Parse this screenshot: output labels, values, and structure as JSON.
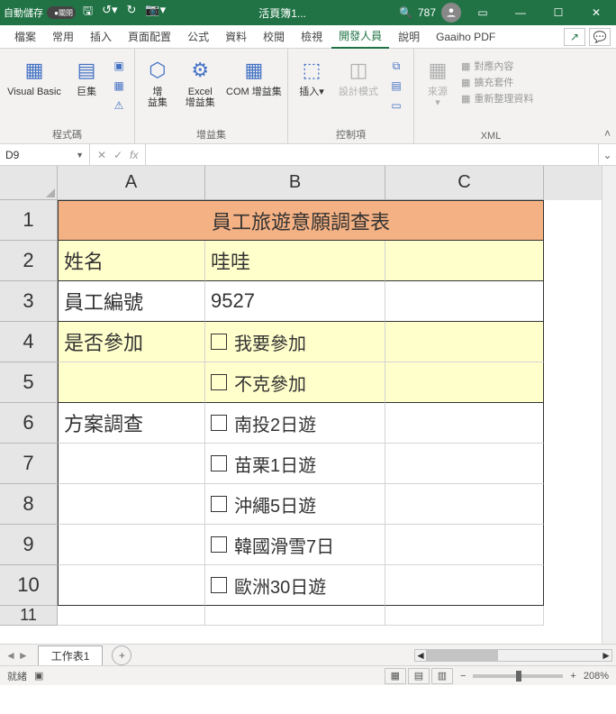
{
  "titlebar": {
    "autosave_label": "自動儲存",
    "autosave_state": "●關閉",
    "doc_name": "活頁簿1...",
    "user_label": "787"
  },
  "menu": {
    "tabs": [
      "檔案",
      "常用",
      "插入",
      "頁面配置",
      "公式",
      "資料",
      "校閱",
      "檢視",
      "開發人員",
      "說明",
      "Gaaiho PDF"
    ],
    "active": "開發人員"
  },
  "ribbon": {
    "group_code": "程式碼",
    "vb_label": "Visual Basic",
    "macro_label": "巨集",
    "group_addins": "增益集",
    "addin_label": "增\n益集",
    "excel_addin_label": "Excel\n增益集",
    "com_addin_label": "COM 增益集",
    "group_controls": "控制項",
    "insert_label": "插入",
    "design_label": "設計模式",
    "group_xml": "XML",
    "source_label": "來源",
    "xml_map": "對應內容",
    "xml_expand": "擴充套件",
    "xml_refresh": "重新整理資料"
  },
  "fbar": {
    "namebox": "D9",
    "fx": "fx"
  },
  "grid": {
    "cols": [
      "A",
      "B",
      "C"
    ],
    "rows": [
      "1",
      "2",
      "3",
      "4",
      "5",
      "6",
      "7",
      "8",
      "9",
      "10",
      "11"
    ],
    "title": "員工旅遊意願調查表",
    "r2a": "姓名",
    "r2b": "哇哇",
    "r3a": "員工編號",
    "r3b": "9527",
    "r4a": "是否參加",
    "r4b": "我要參加",
    "r5b": "不克參加",
    "r6a": "方案調查",
    "r6b": "南投2日遊",
    "r7b": "苗栗1日遊",
    "r8b": "沖繩5日遊",
    "r9b": "韓國滑雪7日",
    "r10b": "歐洲30日遊"
  },
  "sheet": {
    "tab": "工作表1"
  },
  "status": {
    "mode": "就緒",
    "zoom": "208%"
  }
}
